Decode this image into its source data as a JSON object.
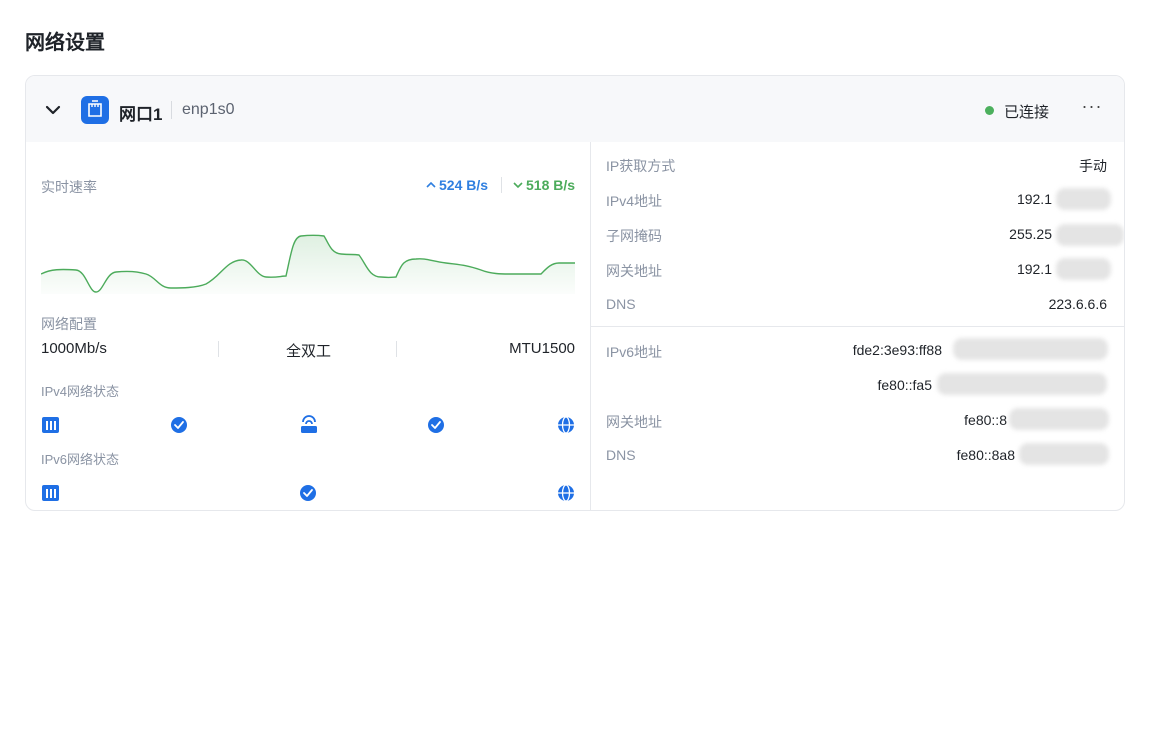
{
  "page_title": "网络设置",
  "port": {
    "name": "网口1",
    "interface": "enp1s0",
    "status": "已连接",
    "status_color": "#4cb05d",
    "more_icon": "more-icon",
    "more_glyph": "···"
  },
  "realtime": {
    "label": "实时速率",
    "upload": "524 B/s",
    "download": "518 B/s",
    "upload_color": "#2f7fe0",
    "download_color": "#4cab5b"
  },
  "config": {
    "label": "网络配置",
    "speed": "1000Mb/s",
    "duplex": "全双工",
    "mtu": "MTU1500"
  },
  "ipv4_status": {
    "label": "IPv4网络状态"
  },
  "ipv6_status": {
    "label": "IPv6网络状态"
  },
  "ipv4": {
    "method_label": "IP获取方式",
    "method_value": "手动",
    "address_label": "IPv4地址",
    "address_value": "192.1",
    "mask_label": "子网掩码",
    "mask_value": "255.25",
    "gateway_label": "网关地址",
    "gateway_value": "192.1",
    "dns_label": "DNS",
    "dns_value": "223.6.6.6"
  },
  "ipv6": {
    "address_label": "IPv6地址",
    "address_value_1": "fde2:3e93:ff88",
    "address_value_2": "fe80::fa5",
    "gateway_label": "网关地址",
    "gateway_value": "fe80::8",
    "dns_label": "DNS",
    "dns_value": "fe80::8a8"
  }
}
